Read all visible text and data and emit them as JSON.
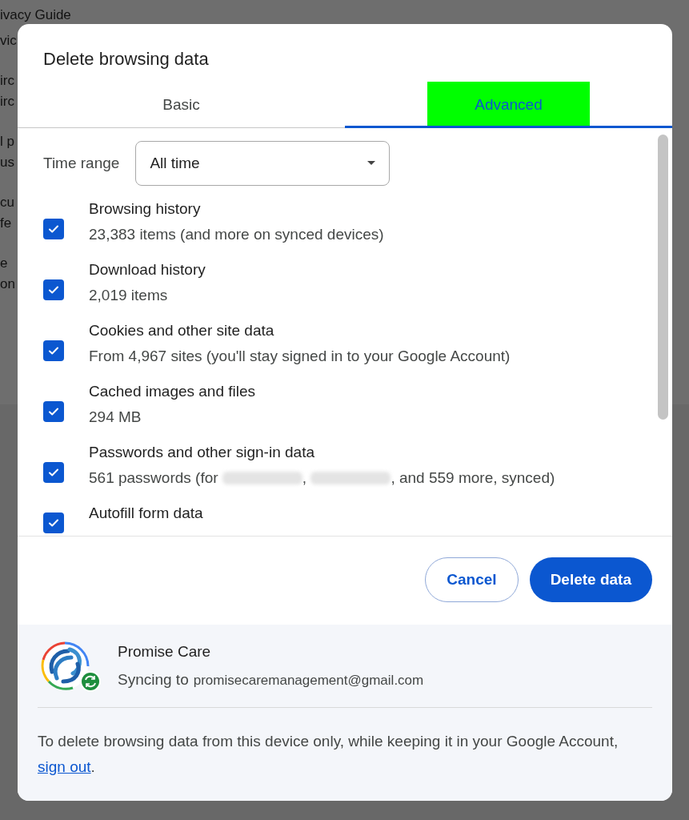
{
  "background_fragments": [
    "ivacy Guide",
    "vic",
    "irc",
    "irc",
    "l p",
    "us",
    "cu",
    "fe",
    "e",
    "on"
  ],
  "dialog": {
    "title": "Delete browsing data",
    "tabs": [
      {
        "label": "Basic",
        "selected": false
      },
      {
        "label": "Advanced",
        "selected": true
      }
    ],
    "time_range": {
      "label": "Time range",
      "value": "All time"
    },
    "items": [
      {
        "title": "Browsing history",
        "detail": [
          {
            "kind": "text",
            "text": "23,383 items (and more on synced devices)"
          }
        ],
        "checked": true
      },
      {
        "title": "Download history",
        "detail": [
          {
            "kind": "text",
            "text": "2,019 items"
          }
        ],
        "checked": true
      },
      {
        "title": "Cookies and other site data",
        "detail": [
          {
            "kind": "text",
            "text": "From 4,967 sites (you'll stay signed in to your Google Account)"
          }
        ],
        "checked": true
      },
      {
        "title": "Cached images and files",
        "detail": [
          {
            "kind": "text",
            "text": "294 MB"
          }
        ],
        "checked": true
      },
      {
        "title": "Passwords and other sign-in data",
        "detail": [
          {
            "kind": "text",
            "text": "561 passwords (for "
          },
          {
            "kind": "redacted"
          },
          {
            "kind": "text",
            "text": ", "
          },
          {
            "kind": "redacted"
          },
          {
            "kind": "text",
            "text": ", and 559 more, synced)"
          }
        ],
        "checked": true
      },
      {
        "title": "Autofill form data",
        "checked": true
      }
    ],
    "buttons": [
      {
        "kind": "secondary",
        "label": "Cancel"
      },
      {
        "kind": "primary",
        "label": "Delete data"
      }
    ],
    "account": {
      "name": "Promise Care",
      "sync_label": "Syncing to",
      "email": "promisecaremanagement@gmail.com"
    },
    "note": {
      "text": "To delete browsing data from this device only, while keeping it in your Google Account, ",
      "link": "sign out",
      "end": "."
    }
  }
}
